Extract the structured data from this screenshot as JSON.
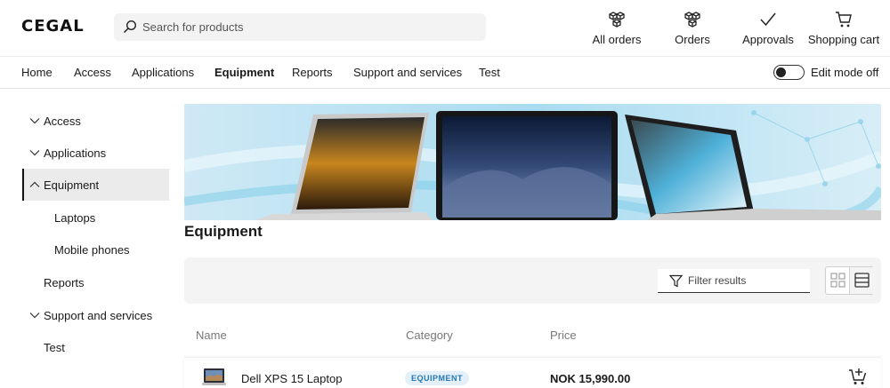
{
  "header": {
    "logo": "CEGAL",
    "search_placeholder": "Search for products",
    "actions": [
      {
        "label": "All orders",
        "icon": "boxes-icon"
      },
      {
        "label": "Orders",
        "icon": "boxes-icon"
      },
      {
        "label": "Approvals",
        "icon": "checkmark-icon"
      },
      {
        "label": "Shopping cart",
        "icon": "cart-icon"
      }
    ]
  },
  "nav": {
    "items": [
      "Home",
      "Access",
      "Applications",
      "Equipment",
      "Reports",
      "Support and services",
      "Test"
    ],
    "active": "Equipment",
    "edit_mode_label": "Edit mode off"
  },
  "sidebar": {
    "items": [
      {
        "label": "Access",
        "expandable": true
      },
      {
        "label": "Applications",
        "expandable": true
      },
      {
        "label": "Equipment",
        "expandable": true,
        "expanded": true,
        "active": true
      },
      {
        "label": "Laptops",
        "sub": true
      },
      {
        "label": "Mobile phones",
        "sub": true
      },
      {
        "label": "Reports"
      },
      {
        "label": "Support and services",
        "expandable": true
      },
      {
        "label": "Test"
      }
    ]
  },
  "main": {
    "title": "Equipment",
    "filter_placeholder": "Filter results",
    "columns": [
      "Name",
      "Category",
      "Price"
    ],
    "rows": [
      {
        "name": "Dell XPS 15 Laptop",
        "category": "EQUIPMENT",
        "price": "NOK 15,990.00"
      }
    ]
  },
  "colors": {
    "badge_bg": "#e3f0fa",
    "badge_text": "#2577b5",
    "toolbar_bg": "#f4f4f4",
    "sidebar_active_bg": "#ebebeb"
  }
}
